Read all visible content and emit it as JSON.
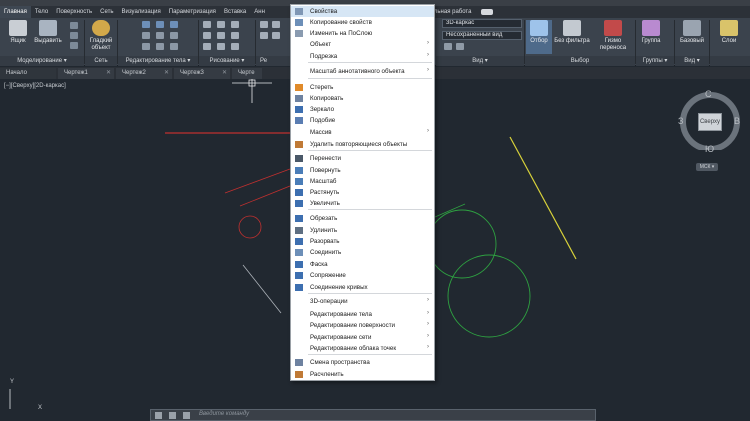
{
  "ribbon_tabs": [
    {
      "label": "Главная",
      "active": true
    },
    {
      "label": "Тело",
      "active": false
    },
    {
      "label": "Поверхность",
      "active": false
    },
    {
      "label": "Сеть",
      "active": false
    },
    {
      "label": "Визуализация",
      "active": false
    },
    {
      "label": "Параметризация",
      "active": false
    },
    {
      "label": "Вставка",
      "active": false
    },
    {
      "label": "Анн",
      "active": false
    },
    {
      "label": "ательная работа",
      "active": false
    }
  ],
  "ribbon": {
    "modeling": {
      "btn1": "Ящик",
      "btn2": "Выдавить",
      "title": "Моделирование ▾"
    },
    "mesh": {
      "btn": "Гладкий объект",
      "title": "Сеть"
    },
    "solid_edit": {
      "title": "Редактирование тела ▾"
    },
    "draw": {
      "title": "Рисование ▾"
    },
    "modify": {
      "title": "Ре"
    },
    "view": {
      "style_combo": "3D-каркас",
      "view_combo": "Несохраненный вид",
      "title": "Вид ▾"
    },
    "selection": {
      "btn1": "Отбор",
      "btn2": "Без фильтра",
      "btn3": "Гизмо переноса",
      "title": "Выбор"
    },
    "groups": {
      "btn": "Группа",
      "title": "Группы ▾"
    },
    "base": {
      "btn": "Базовый",
      "title": "Вид ▾"
    },
    "layers": {
      "btn": "Слои"
    }
  },
  "doc_tabs": [
    {
      "label": "Начало"
    },
    {
      "label": "Чертеж1"
    },
    {
      "label": "Чертеж2"
    },
    {
      "label": "Чертеж3"
    },
    {
      "label": "Черте"
    }
  ],
  "viewport": {
    "label": "[−][Сверху][2D-каркас]"
  },
  "navcube": {
    "north": "С",
    "south": "Ю",
    "west": "З",
    "east": "В",
    "face": "Сверху",
    "wcs": "МСК ▾"
  },
  "ucs": {
    "y_label": "Y",
    "x_label": "X"
  },
  "cmdline": {
    "placeholder": "Введите команду"
  },
  "context_menu": {
    "items": [
      {
        "label": "Свойства",
        "icon": "properties-icon",
        "arrow": false,
        "highlight": true
      },
      {
        "label": "Копирование свойств",
        "icon": "match-properties-icon",
        "arrow": false
      },
      {
        "label": "Изменить на ПоСлою",
        "icon": "bylayer-icon",
        "arrow": false
      },
      {
        "label": "Объект",
        "icon": "",
        "arrow": true
      },
      {
        "label": "Подрезка",
        "icon": "",
        "arrow": true
      },
      {
        "label": "Масштаб аннотативного объекта",
        "icon": "",
        "arrow": true
      },
      {
        "label": "Стереть",
        "icon": "erase-icon",
        "arrow": false
      },
      {
        "label": "Копировать",
        "icon": "copy-icon",
        "arrow": false
      },
      {
        "label": "Зеркало",
        "icon": "mirror-icon",
        "arrow": false
      },
      {
        "label": "Подобие",
        "icon": "offset-icon",
        "arrow": false
      },
      {
        "label": "Массив",
        "icon": "",
        "arrow": true
      },
      {
        "label": "Удалить повторяющиеся объекты",
        "icon": "overkill-icon",
        "arrow": false
      },
      {
        "label": "Перенести",
        "icon": "move-icon",
        "arrow": false
      },
      {
        "label": "Повернуть",
        "icon": "rotate-icon",
        "arrow": false
      },
      {
        "label": "Масштаб",
        "icon": "scale-icon",
        "arrow": false
      },
      {
        "label": "Растянуть",
        "icon": "stretch-icon",
        "arrow": false
      },
      {
        "label": "Увеличить",
        "icon": "lengthen-icon",
        "arrow": false
      },
      {
        "label": "Обрезать",
        "icon": "trim-icon",
        "arrow": false
      },
      {
        "label": "Удлинить",
        "icon": "extend-icon",
        "arrow": false
      },
      {
        "label": "Разорвать",
        "icon": "break-icon",
        "arrow": false
      },
      {
        "label": "Соединить",
        "icon": "join-icon",
        "arrow": false
      },
      {
        "label": "Фаска",
        "icon": "chamfer-icon",
        "arrow": false
      },
      {
        "label": "Сопряжение",
        "icon": "fillet-icon",
        "arrow": false
      },
      {
        "label": "Соединение кривых",
        "icon": "blend-curves-icon",
        "arrow": false
      },
      {
        "label": "3D-операции",
        "icon": "",
        "arrow": true
      },
      {
        "label": "Редактирование тела",
        "icon": "",
        "arrow": true
      },
      {
        "label": "Редактирование поверхности",
        "icon": "",
        "arrow": true
      },
      {
        "label": "Редактирование сети",
        "icon": "",
        "arrow": true
      },
      {
        "label": "Редактирование облака точек",
        "icon": "",
        "arrow": true
      },
      {
        "label": "Смена пространства",
        "icon": "change-space-icon",
        "arrow": false
      },
      {
        "label": "Расчленить",
        "icon": "explode-icon",
        "arrow": false
      }
    ]
  },
  "colors": {
    "background": "#212830",
    "ribbon": "#3b434d",
    "menu_bg": "#ffffff",
    "highlight": "#d6e6f5",
    "red_lines": "#c0302f",
    "green_circles": "#2ea041",
    "yellow_line": "#d8d23a"
  }
}
